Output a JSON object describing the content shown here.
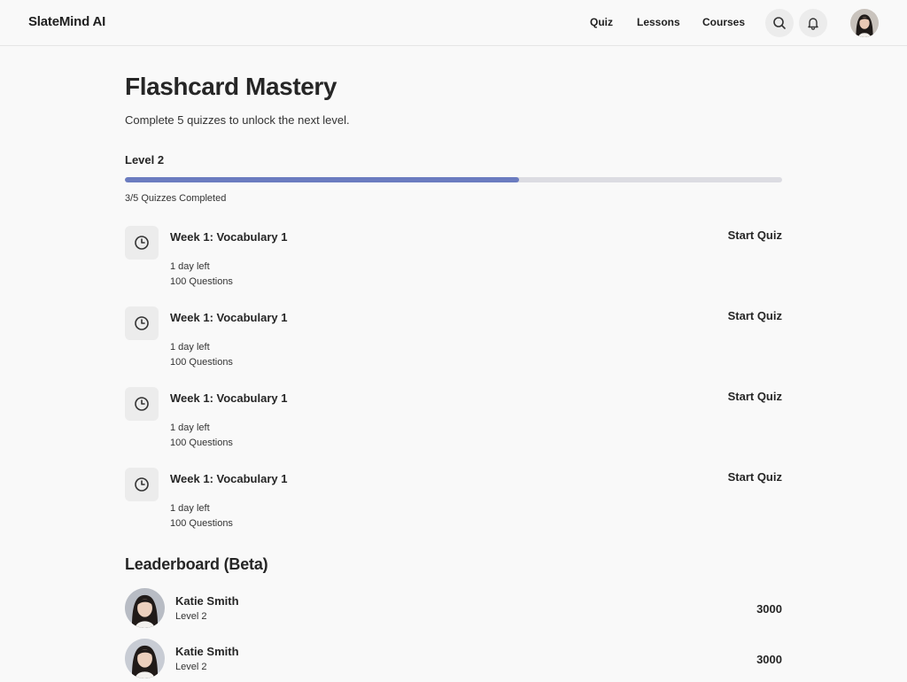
{
  "app": {
    "brand": "SlateMind AI"
  },
  "nav": {
    "links": [
      "Quiz",
      "Lessons",
      "Courses"
    ],
    "icons": [
      "search-icon",
      "bell-icon"
    ]
  },
  "page": {
    "title": "Flashcard Mastery",
    "subtitle": "Complete 5 quizzes to unlock the next level.",
    "level_label": "Level 2",
    "progress": {
      "completed": 3,
      "total": 5,
      "fraction": 0.6,
      "text": "3/5 Quizzes Completed"
    }
  },
  "quizzes": [
    {
      "title": "Week 1: Vocabulary 1",
      "time_left": "1 day left",
      "questions": "100 Questions",
      "action": "Start Quiz"
    },
    {
      "title": "Week 1: Vocabulary 1",
      "time_left": "1 day left",
      "questions": "100 Questions",
      "action": "Start Quiz"
    },
    {
      "title": "Week 1: Vocabulary 1",
      "time_left": "1 day left",
      "questions": "100 Questions",
      "action": "Start Quiz"
    },
    {
      "title": "Week 1: Vocabulary 1",
      "time_left": "1 day left",
      "questions": "100 Questions",
      "action": "Start Quiz"
    }
  ],
  "leaderboard": {
    "title": "Leaderboard (Beta)",
    "entries": [
      {
        "name": "Katie Smith",
        "level": "Level 2",
        "score": "3000"
      },
      {
        "name": "Katie Smith",
        "level": "Level 2",
        "score": "3000"
      }
    ]
  },
  "colors": {
    "progress_fill": "#6b7cc0",
    "progress_track": "#dcdce2",
    "background": "#f9f9f9"
  }
}
